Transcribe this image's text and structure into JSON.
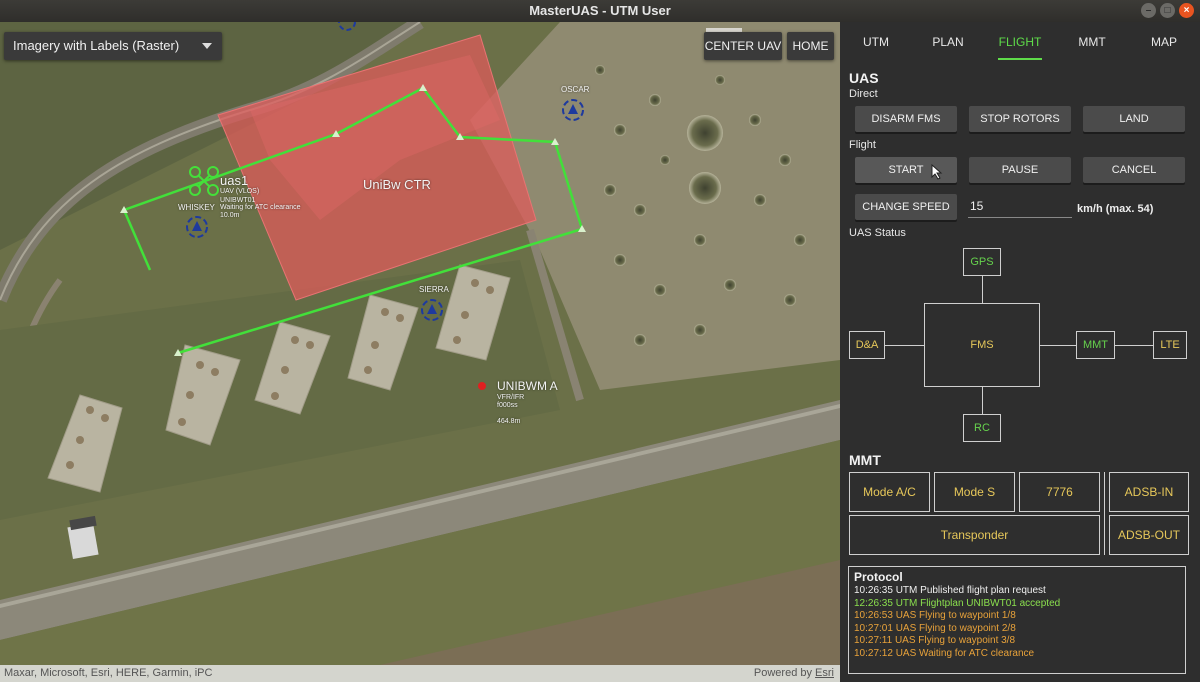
{
  "window": {
    "title": "MasterUAS - UTM User"
  },
  "map": {
    "basemap": "Imagery with Labels (Raster)",
    "buttons": {
      "center": "CENTER UAV",
      "home": "HOME"
    },
    "attribution": "Maxar, Microsoft, Esri, HERE, Garmin, iPC",
    "powered_prefix": "Powered by ",
    "powered_link": "Esri",
    "zone_label": "UniBw CTR",
    "waypoints": [
      "OSCAR",
      "WHISKEY",
      "SIERRA"
    ],
    "uas": {
      "name": "uas1",
      "type": "UAV (VLOS)",
      "flight": "UNIBWT01",
      "state": "Waiting for ATC clearance",
      "alt": "10.0m"
    },
    "aircraft": {
      "name": "UNIBWM A",
      "rules": "VFR/IFR",
      "alt1": "f000ss",
      "alt2": "464.8m"
    },
    "colors": {
      "zone": "#e05050",
      "route": "#44e03a",
      "waypoint": "#1e3a9e",
      "aircraft": "#e02020"
    }
  },
  "panel": {
    "tabs": [
      {
        "label": "UTM"
      },
      {
        "label": "PLAN"
      },
      {
        "label": "FLIGHT"
      },
      {
        "label": "MMT"
      },
      {
        "label": "MAP"
      }
    ],
    "uas_title": "UAS",
    "direct_label": "Direct",
    "direct_buttons": [
      "DISARM FMS",
      "STOP ROTORS",
      "LAND"
    ],
    "flight_label": "Flight",
    "flight_buttons": [
      "START",
      "PAUSE",
      "CANCEL"
    ],
    "change_speed": "CHANGE SPEED",
    "speed_value": "15",
    "speed_unit": "km/h (max. 54)",
    "status_label": "UAS Status",
    "status": {
      "gps": "GPS",
      "da": "D&A",
      "fms": "FMS",
      "mmt": "MMT",
      "lte": "LTE",
      "rc": "RC"
    },
    "mmt_title": "MMT",
    "mmt": {
      "mode_ac": "Mode A/C",
      "mode_s": "Mode S",
      "code": "7776",
      "adsb_in": "ADSB-IN",
      "transponder": "Transponder",
      "adsb_out": "ADSB-OUT"
    },
    "protocol_title": "Protocol",
    "log": [
      {
        "text": "10:26:35 UTM Published flight plan request",
        "color": "#f0f0f0"
      },
      {
        "text": "12:26:35 UTM Flightplan UNIBWT01 accepted",
        "color": "#8be04e"
      },
      {
        "text": "10:26:53 UAS Flying to waypoint 1/8",
        "color": "#e8a23a"
      },
      {
        "text": "10:27:01 UAS Flying to waypoint 2/8",
        "color": "#e8a23a"
      },
      {
        "text": "10:27:11 UAS Flying to waypoint 3/8",
        "color": "#e8a23a"
      },
      {
        "text": "10:27:12 UAS Waiting for ATC clearance",
        "color": "#e8a23a"
      }
    ]
  }
}
